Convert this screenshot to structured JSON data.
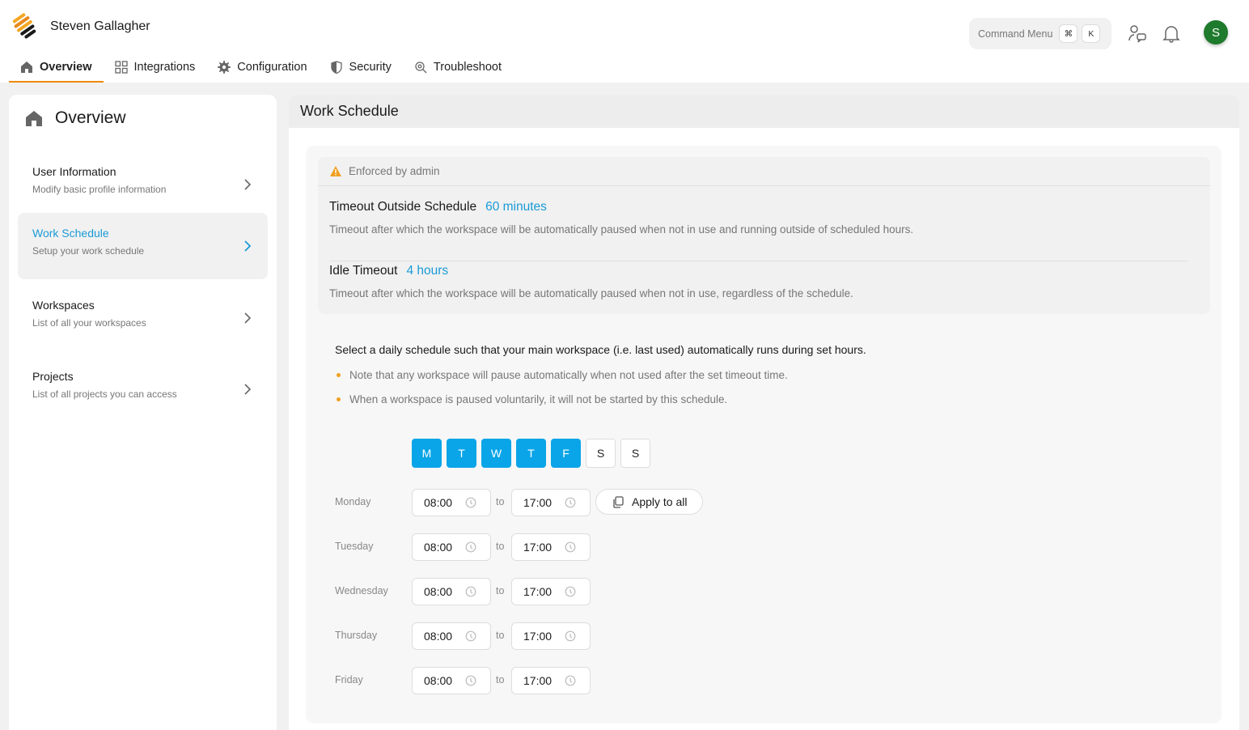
{
  "header": {
    "user_name": "Steven Gallagher",
    "command_menu": {
      "label": "Command Menu",
      "keys": [
        "⌘",
        "K"
      ]
    },
    "avatar_initial": "S",
    "avatar_color": "#1e7a2c"
  },
  "nav": {
    "tabs": [
      {
        "label": "Overview",
        "icon": "home-icon",
        "active": true
      },
      {
        "label": "Integrations",
        "icon": "grid-icon"
      },
      {
        "label": "Configuration",
        "icon": "gear-icon"
      },
      {
        "label": "Security",
        "icon": "shield-icon"
      },
      {
        "label": "Troubleshoot",
        "icon": "troubleshoot-icon"
      }
    ]
  },
  "sidebar": {
    "title": "Overview",
    "items": [
      {
        "label": "User Information",
        "sub": "Modify basic profile information"
      },
      {
        "label": "Work Schedule",
        "sub": "Setup your work schedule",
        "active": true
      },
      {
        "label": "Workspaces",
        "sub": "List of all your workspaces"
      },
      {
        "label": "Projects",
        "sub": "List of all projects you can access"
      }
    ]
  },
  "main": {
    "title": "Work Schedule",
    "enforced": {
      "label": "Enforced by admin",
      "outside": {
        "title": "Timeout Outside Schedule",
        "value": "60 minutes",
        "desc": "Timeout after which the workspace will be automatically paused when not in use and running outside of scheduled hours."
      },
      "idle": {
        "title": "Idle Timeout",
        "value": "4 hours",
        "desc": "Timeout after which the workspace will be automatically paused when not in use, regardless of the schedule."
      }
    },
    "intro": "Select a daily schedule such that your main workspace (i.e. last used) automatically runs during set hours.",
    "notes": [
      "Note that any workspace will pause automatically when not used after the set timeout time.",
      "When a workspace is paused voluntarily, it will not be started by this schedule."
    ],
    "days": [
      {
        "label": "M",
        "on": true
      },
      {
        "label": "T",
        "on": true
      },
      {
        "label": "W",
        "on": true
      },
      {
        "label": "T",
        "on": true
      },
      {
        "label": "F",
        "on": true
      },
      {
        "label": "S",
        "on": false
      },
      {
        "label": "S",
        "on": false
      }
    ],
    "to_label": "to",
    "apply_label": "Apply to all",
    "schedule": [
      {
        "day": "Monday",
        "start": "08:00",
        "end": "17:00"
      },
      {
        "day": "Tuesday",
        "start": "08:00",
        "end": "17:00"
      },
      {
        "day": "Wednesday",
        "start": "08:00",
        "end": "17:00"
      },
      {
        "day": "Thursday",
        "start": "08:00",
        "end": "17:00"
      },
      {
        "day": "Friday",
        "start": "08:00",
        "end": "17:00"
      }
    ]
  },
  "colors": {
    "accent": "#1a9ad6",
    "day_on": "#0aa5e8",
    "tab_underline": "#f08a00",
    "warning": "#f0a020"
  }
}
